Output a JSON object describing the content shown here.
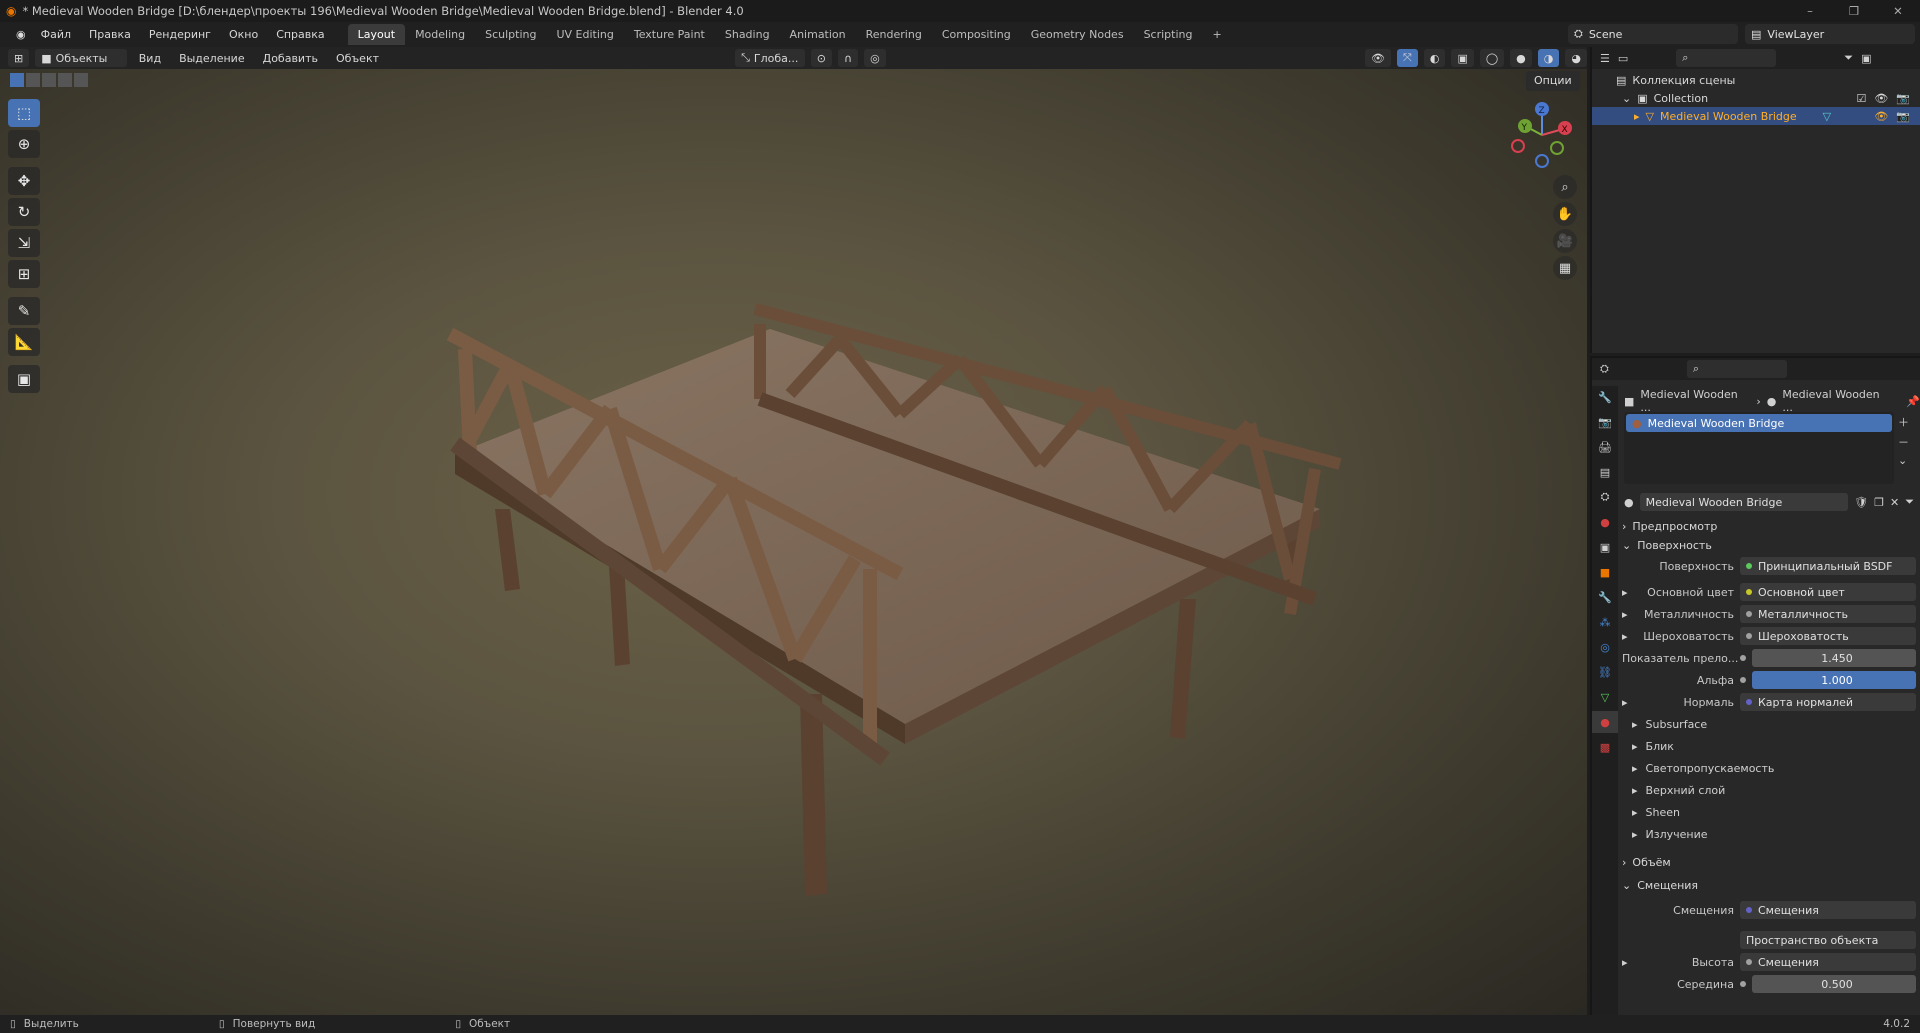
{
  "window": {
    "title": "* Medieval Wooden Bridge [D:\\блендер\\проекты 196\\Medieval Wooden Bridge\\Medieval Wooden Bridge.blend] - Blender 4.0",
    "controls": [
      "–",
      "❐",
      "✕"
    ]
  },
  "menu": [
    "Файл",
    "Правка",
    "Рендеринг",
    "Окно",
    "Справка"
  ],
  "workspaces": [
    {
      "label": "Layout",
      "active": true
    },
    {
      "label": "Modeling"
    },
    {
      "label": "Sculpting"
    },
    {
      "label": "UV Editing"
    },
    {
      "label": "Texture Paint"
    },
    {
      "label": "Shading"
    },
    {
      "label": "Animation"
    },
    {
      "label": "Rendering"
    },
    {
      "label": "Compositing"
    },
    {
      "label": "Geometry Nodes"
    },
    {
      "label": "Scripting"
    },
    {
      "label": "+"
    }
  ],
  "scene": {
    "name": "Scene",
    "view_layer": "ViewLayer"
  },
  "viewport_header": {
    "mode": "Объекты",
    "menus": [
      "Вид",
      "Выделение",
      "Добавить",
      "Объект"
    ],
    "transform": "Глоба...",
    "options": "Опции"
  },
  "gizmo": {
    "x": "X",
    "y": "Y",
    "z": "Z"
  },
  "outliner": {
    "root": "Коллекция сцены",
    "collection": "Collection",
    "object": "Medieval Wooden Bridge"
  },
  "properties": {
    "breadcrumb": [
      "Medieval Wooden ...",
      "Medieval Wooden ..."
    ],
    "material_slot": "Medieval Wooden Bridge",
    "material_name": "Medieval Wooden Bridge",
    "sections": {
      "preview": "Предпросмотр",
      "surface": "Поверхность",
      "volume": "Объём",
      "displacement": "Смещения"
    },
    "surface": {
      "label": "Поверхность",
      "value": "Принципиальный BSDF"
    },
    "inputs": [
      {
        "label": "Основной цвет",
        "value": "Основной цвет",
        "dot": "#c7c729"
      },
      {
        "label": "Металличность",
        "value": "Металличность",
        "dot": "#a1a1a1"
      },
      {
        "label": "Шероховатость",
        "value": "Шероховатость",
        "dot": "#a1a1a1"
      }
    ],
    "ior": {
      "label": "Показатель прело...",
      "value": "1.450"
    },
    "alpha": {
      "label": "Альфа",
      "value": "1.000"
    },
    "normal": {
      "label": "Нормаль",
      "value": "Карта нормалей"
    },
    "subpanels": [
      "Subsurface",
      "Блик",
      "Светопропускаемость",
      "Верхний слой",
      "Sheen",
      "Излучение"
    ],
    "disp": {
      "label": "Смещения",
      "value": "Смещения",
      "space": "Пространство объекта",
      "height_label": "Высота",
      "height_value": "Смещения",
      "mid_label": "Середина",
      "mid_value": "0.500"
    }
  },
  "status": {
    "select": "Выделить",
    "rotate": "Повернуть вид",
    "object": "Объект",
    "version": "4.0.2"
  },
  "colors": {
    "accent": "#4772b3",
    "selected_text": "#ffaf29"
  }
}
